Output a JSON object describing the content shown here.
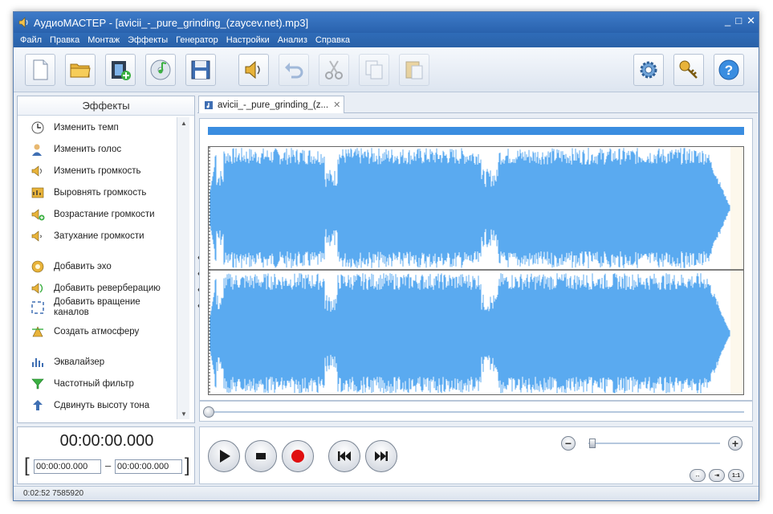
{
  "window": {
    "title": "АудиоМАСТЕР - [avicii_-_pure_grinding_(zaycev.net).mp3]",
    "controls": [
      "_",
      "□",
      "✕"
    ]
  },
  "menu": [
    "Файл",
    "Правка",
    "Монтаж",
    "Эффекты",
    "Генератор",
    "Настройки",
    "Анализ",
    "Справка"
  ],
  "panel": {
    "title": "Эффекты",
    "collapse_glyph": "‹",
    "scroll_up": "▲",
    "scroll_down": "▼"
  },
  "effects": [
    {
      "label": "Изменить темп",
      "icon": "clock-icon"
    },
    {
      "label": "Изменить голос",
      "icon": "user-voice-icon"
    },
    {
      "label": "Изменить громкость",
      "icon": "volume-icon"
    },
    {
      "label": "Выровнять громкость",
      "icon": "normalize-icon"
    },
    {
      "label": "Возрастание громкости",
      "icon": "fade-in-icon"
    },
    {
      "label": "Затухание громкости",
      "icon": "fade-out-icon"
    },
    {
      "label": "Добавить эхо",
      "icon": "echo-icon"
    },
    {
      "label": "Добавить реверберацию",
      "icon": "reverb-icon"
    },
    {
      "label": "Добавить вращение каналов",
      "icon": "rotate-channels-icon"
    },
    {
      "label": "Создать атмосферу",
      "icon": "atmosphere-icon"
    },
    {
      "label": "Эквалайзер",
      "icon": "equalizer-icon"
    },
    {
      "label": "Частотный фильтр",
      "icon": "filter-icon"
    },
    {
      "label": "Сдвинуть высоту тона",
      "icon": "pitch-shift-icon"
    }
  ],
  "tab": {
    "label": "avicii_-_pure_grinding_(z...",
    "close": "✕"
  },
  "time": {
    "current": "00:00:00.000",
    "start": "00:00:00.000",
    "end": "00:00:00.000",
    "bracket_left": "[",
    "bracket_right": "]",
    "separator": "–"
  },
  "zoom": {
    "minus": "−",
    "plus": "+",
    "level": 0.02,
    "fit_label": "↔",
    "selection_label": "⇥",
    "one_to_one_label": "1:1"
  },
  "status": "0:02:52 7585920",
  "colors": {
    "waveform": "#5aaaf0",
    "accent": "#3a8de0",
    "record": "#e01010"
  }
}
